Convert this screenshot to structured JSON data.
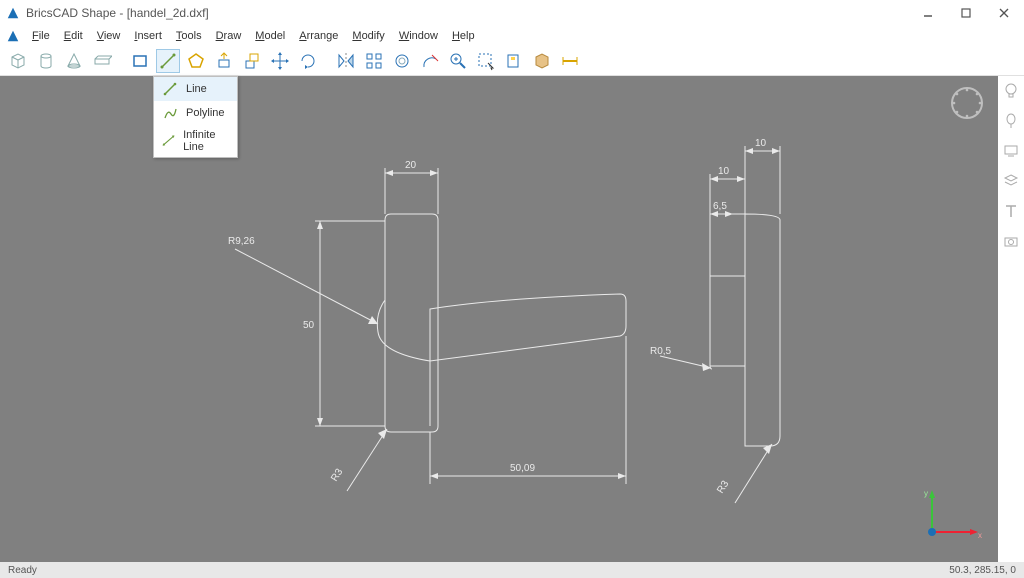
{
  "app": {
    "title": "BricsCAD Shape - [handel_2d.dxf]"
  },
  "menu": {
    "items": [
      {
        "mn": "F",
        "rest": "ile"
      },
      {
        "mn": "E",
        "rest": "dit"
      },
      {
        "mn": "V",
        "rest": "iew"
      },
      {
        "mn": "I",
        "rest": "nsert"
      },
      {
        "mn": "T",
        "rest": "ools"
      },
      {
        "mn": "D",
        "rest": "raw"
      },
      {
        "mn": "M",
        "rest": "odel"
      },
      {
        "mn": "A",
        "rest": "rrange"
      },
      {
        "mn": "M",
        "rest": "odify"
      },
      {
        "mn": "W",
        "rest": "indow"
      },
      {
        "mn": "H",
        "rest": "elp"
      }
    ]
  },
  "dropdown": {
    "items": [
      {
        "label": "Line"
      },
      {
        "label": "Polyline"
      },
      {
        "label": "Infinite Line"
      }
    ]
  },
  "dims": {
    "d50": "50",
    "d20": "20",
    "r926": "R9,26",
    "r3a": "R3",
    "d5009": "50,09",
    "d10a": "10",
    "d10b": "10",
    "d65": "6,5",
    "r05": "R0,5",
    "r3b": "R3"
  },
  "status": {
    "ready": "Ready",
    "coords": "50.3, 285.15, 0"
  },
  "axis": {
    "x": "x",
    "y": "y"
  }
}
